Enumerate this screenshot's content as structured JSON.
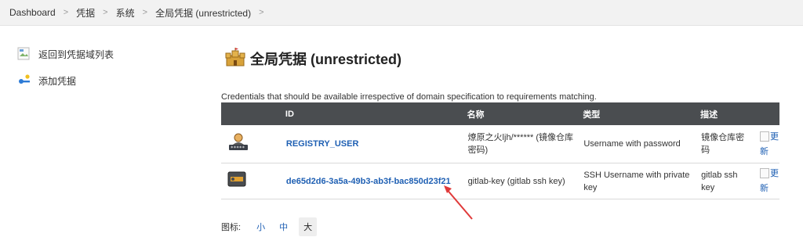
{
  "breadcrumb": [
    "Dashboard",
    "凭据",
    "系统",
    "全局凭据 (unrestricted)"
  ],
  "sidebar": {
    "items": [
      {
        "label": "返回到凭据域列表",
        "icon": "broken-image-icon"
      },
      {
        "label": "添加凭据",
        "icon": "add-credential-key-icon"
      }
    ]
  },
  "page": {
    "title": "全局凭据 (unrestricted)",
    "title_icon": "castle-domain-icon",
    "description": "Credentials that should be available irrespective of domain specification to requirements matching."
  },
  "table": {
    "headers": [
      "ID",
      "名称",
      "类型",
      "描述"
    ],
    "rows": [
      {
        "icon": "user-password-icon",
        "id": "REGISTRY_USER",
        "name_line1": "燎原之火ljh/****** (镜像仓库",
        "name_line2": "密码)",
        "type_line1": "Username with password",
        "type_line2": "",
        "desc_line1": "镜像仓库密",
        "desc_line2": "码",
        "update_line1": "更",
        "update_line2": "新"
      },
      {
        "icon": "ssh-key-icon",
        "id": "de65d2d6-3a5a-49b3-ab3f-bac850d23f21",
        "name_line1": "gitlab-key (gitlab ssh key)",
        "name_line2": "",
        "type_line1": "SSH Username with private",
        "type_line2": "key",
        "desc_line1": "gitlab ssh",
        "desc_line2": "key",
        "update_line1": "更",
        "update_line2": "新"
      }
    ]
  },
  "icon_size": {
    "label": "图标:",
    "options": [
      "小",
      "中",
      "大"
    ],
    "selected": "大"
  },
  "colors": {
    "link": "#1e5fb3",
    "header_bg": "#4a4d50",
    "annotation_arrow": "#e03a3a"
  }
}
